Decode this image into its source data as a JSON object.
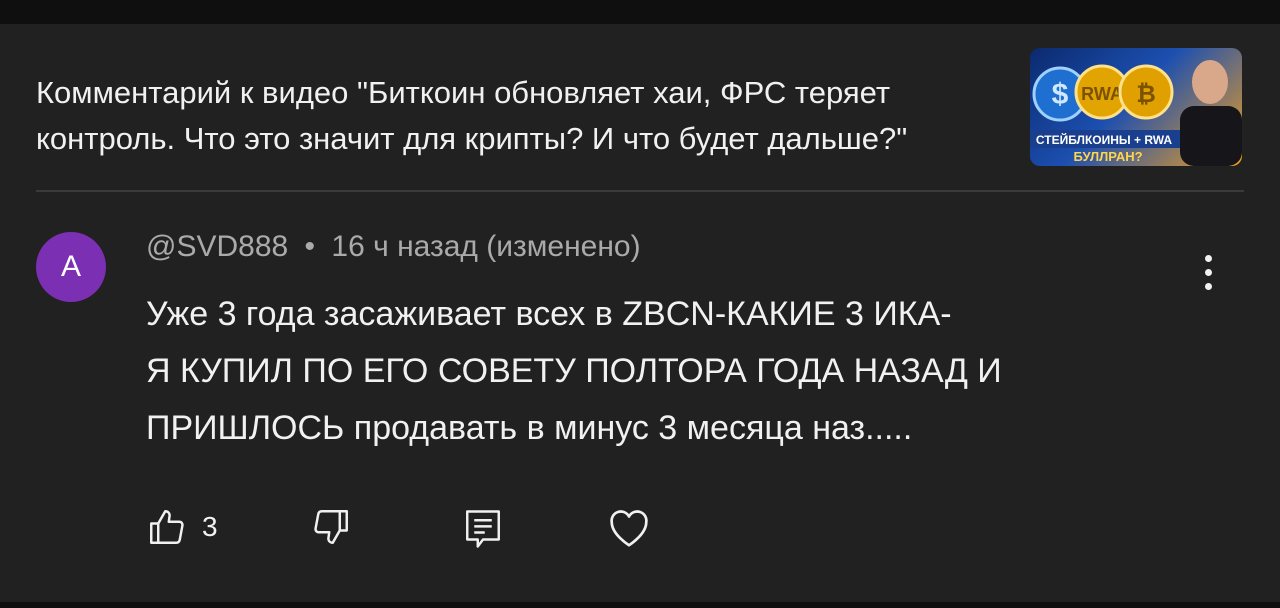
{
  "header": {
    "title": "Комментарий к видео \"Биткоин обновляет хаи, ФРС теряет контроль. Что это значит для крипты? И что будет дальше?\"",
    "thumbnail": {
      "text_line1": "СТЕЙБЛКОИНЫ + RWA",
      "text_line2": "БУЛЛРАН?"
    }
  },
  "comment": {
    "avatar_letter": "A",
    "author": "@SVD888",
    "separator": "•",
    "time": "16 ч назад (изменено)",
    "text_lines": [
      "Уже 3 года засаживает всех в ZBCN-КАКИЕ 3 ИКА-",
      "Я КУПИЛ ПО ЕГО СОВЕТУ ПОЛТОРА ГОДА НАЗАД И",
      "ПРИШЛОСЬ продавать в минус 3 месяца наз....."
    ],
    "like_count": "3"
  },
  "colors": {
    "background": "#212121",
    "avatar": "#7b2fb3",
    "meta_text": "#aaaaaa"
  },
  "icons": [
    "thumb-up-icon",
    "thumb-down-icon",
    "reply-icon",
    "heart-icon",
    "more-vert-icon"
  ]
}
